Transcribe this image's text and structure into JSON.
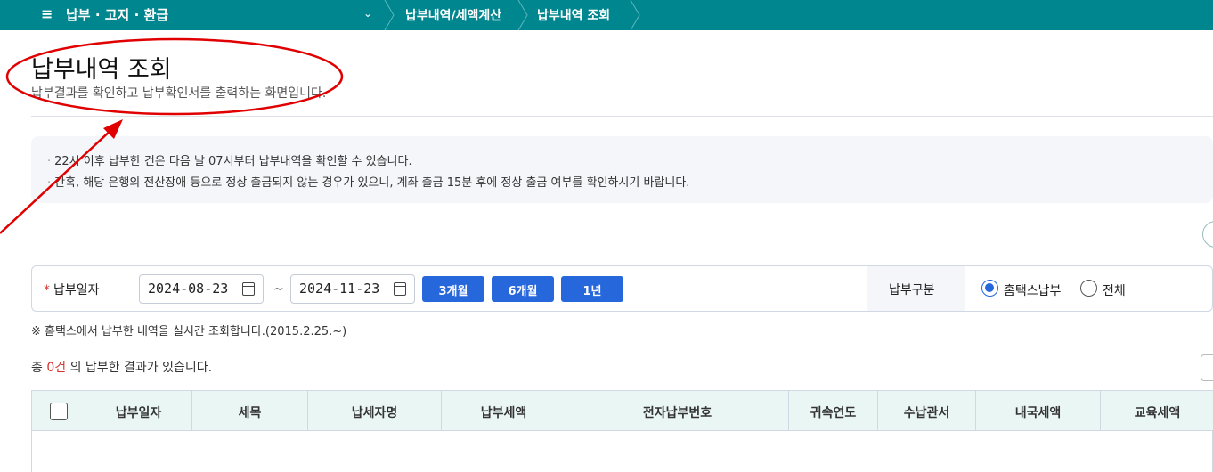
{
  "nav": {
    "menu_icon": "menu-icon",
    "title": "납부 · 고지 · 환급",
    "crumbs": [
      "납부내역/세액계산",
      "납부내역 조회"
    ]
  },
  "page": {
    "title": "납부내역 조회",
    "desc": "납부결과를 확인하고 납부확인서를 출력하는 화면입니다."
  },
  "notice": [
    "22시 이후 납부한 건은 다음 날 07시부터 납부내역을 확인할 수 있습니다.",
    "간혹, 해당 은행의 전산장애 등으로 정상 출금되지 않는 경우가 있으니, 계좌 출금 15분 후에 정상 출금 여부를 확인하시기 바랍니다."
  ],
  "search": {
    "required_mark": "*",
    "date_label": "납부일자",
    "date_from": "2024-08-23",
    "date_to": "2024-11-23",
    "tilde": "~",
    "period_buttons": [
      "3개월",
      "6개월",
      "1년"
    ],
    "type_label": "납부구분",
    "type_options": [
      "홈택스납부",
      "전체"
    ],
    "type_selected": "홈택스납부"
  },
  "note": "※ 홈택스에서 납부한 내역을 실시간 조회합니다.(2015.2.25.~)",
  "result": {
    "prefix": "총",
    "count": "0건",
    "suffix": "의 납부한 결과가 있습니다."
  },
  "table": {
    "columns": [
      "납부일자",
      "세목",
      "납세자명",
      "납부세액",
      "전자납부번호",
      "귀속연도",
      "수납관서",
      "내국세액",
      "교육세액"
    ]
  },
  "colors": {
    "nav": "#00868f",
    "primary": "#2667dc",
    "annotation": "#e00000"
  }
}
